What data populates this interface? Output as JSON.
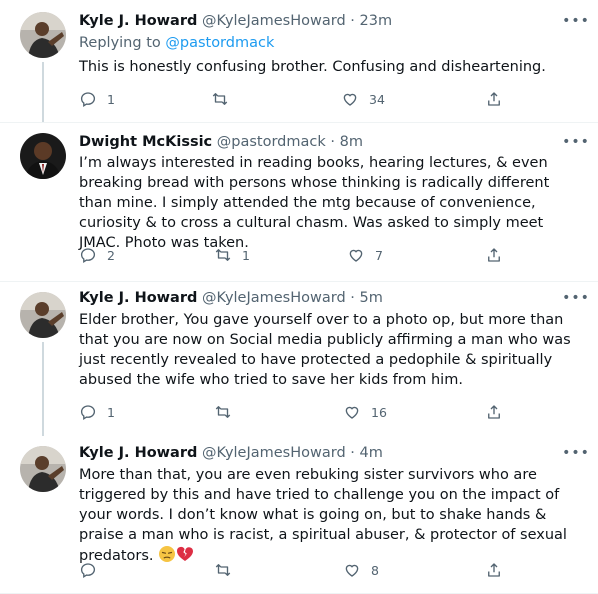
{
  "tweets": [
    {
      "name": "Kyle J. Howard",
      "handle": "@KyleJamesHoward",
      "sep": "·",
      "time": "23m",
      "replying_prefix": "Replying to ",
      "replying_to": "@pastordmack",
      "text": "This is honestly confusing brother. Confusing and disheartening.",
      "replies": "1",
      "retweets": "",
      "likes": "34",
      "avatar_bg": "#a9a9a9"
    },
    {
      "name": "Dwight McKissic",
      "handle": "@pastordmack",
      "sep": "·",
      "time": "8m",
      "text": "I’m always interested in reading books, hearing lectures, & even breaking bread with persons whose thinking is radically different than mine. I simply attended the mtg because of convenience, curiosity & to cross a cultural chasm. Was asked to simply meet JMAC. Photo was taken.",
      "replies": "2",
      "retweets": "1",
      "likes": "7",
      "avatar_bg": "#1a1a1a"
    },
    {
      "name": "Kyle J. Howard",
      "handle": "@KyleJamesHoward",
      "sep": "·",
      "time": "5m",
      "text": "Elder brother, You gave yourself over to a photo op, but more than that you are now on Social media publicly affirming a man who was just recently revealed to have protected a pedophile & spiritually abused the wife who tried to save her kids from him.",
      "replies": "1",
      "retweets": "",
      "likes": "16",
      "avatar_bg": "#a9a9a9"
    },
    {
      "name": "Kyle J. Howard",
      "handle": "@KyleJamesHoward",
      "sep": "·",
      "time": "4m",
      "text": "More than that, you are even rebuking sister survivors who are triggered by this and have tried to challenge you on the impact of your words. I don’t know what is going on, but to shake hands & praise a man who is racist, a spiritual abuser, & protector of sexual predators. ",
      "emojis": [
        "pensive-face",
        "broken-heart"
      ],
      "replies": "",
      "retweets": "",
      "likes": "8",
      "avatar_bg": "#a9a9a9"
    }
  ],
  "more_label": "•••",
  "colors": {
    "link": "#1d9bf0",
    "muted": "#536471",
    "line": "#cfd9de"
  }
}
